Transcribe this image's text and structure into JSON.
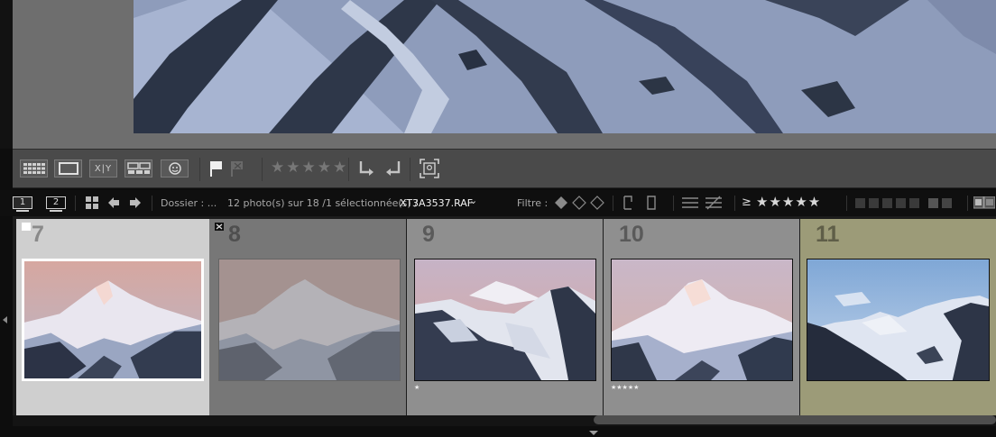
{
  "toolbar": {
    "grid_icon": "grid-view-icon",
    "loupe_icon": "loupe-view-icon",
    "compare_label": "X|Y",
    "survey_icon": "survey-view-icon",
    "people_icon": "people-view-icon",
    "flag_icon": "pick-flag-icon",
    "reject_icon": "reject-flag-icon",
    "stars": "★★★★★",
    "rotate_left_icon": "rotate-left-icon",
    "rotate_right_icon": "rotate-right-icon",
    "crop_icon": "crop-overlay-icon"
  },
  "filmstrip_header": {
    "monitor1": "1",
    "monitor2": "2",
    "folder_label": "Dossier : ...",
    "count_text": "12 photo(s) sur 18 /1 sélectionnée(s) /",
    "filename": "XT3A3537.RAF",
    "filename_caret": "⌄",
    "filter_label": "Filtre :",
    "filter_gte": "≥",
    "filter_stars": "★★★★★"
  },
  "cells": [
    {
      "number": "7",
      "rating": ""
    },
    {
      "number": "8",
      "rating": ""
    },
    {
      "number": "9",
      "rating": "★"
    },
    {
      "number": "10",
      "rating": "★★★★★"
    },
    {
      "number": "11",
      "rating": ""
    }
  ],
  "colors": {
    "cell_selected": "#cfcfcf",
    "cell_normal": "#8f8f8f",
    "cell_dim": "#777777",
    "cell_label": "#9c9b78",
    "number_color": "#5a5a5a"
  }
}
